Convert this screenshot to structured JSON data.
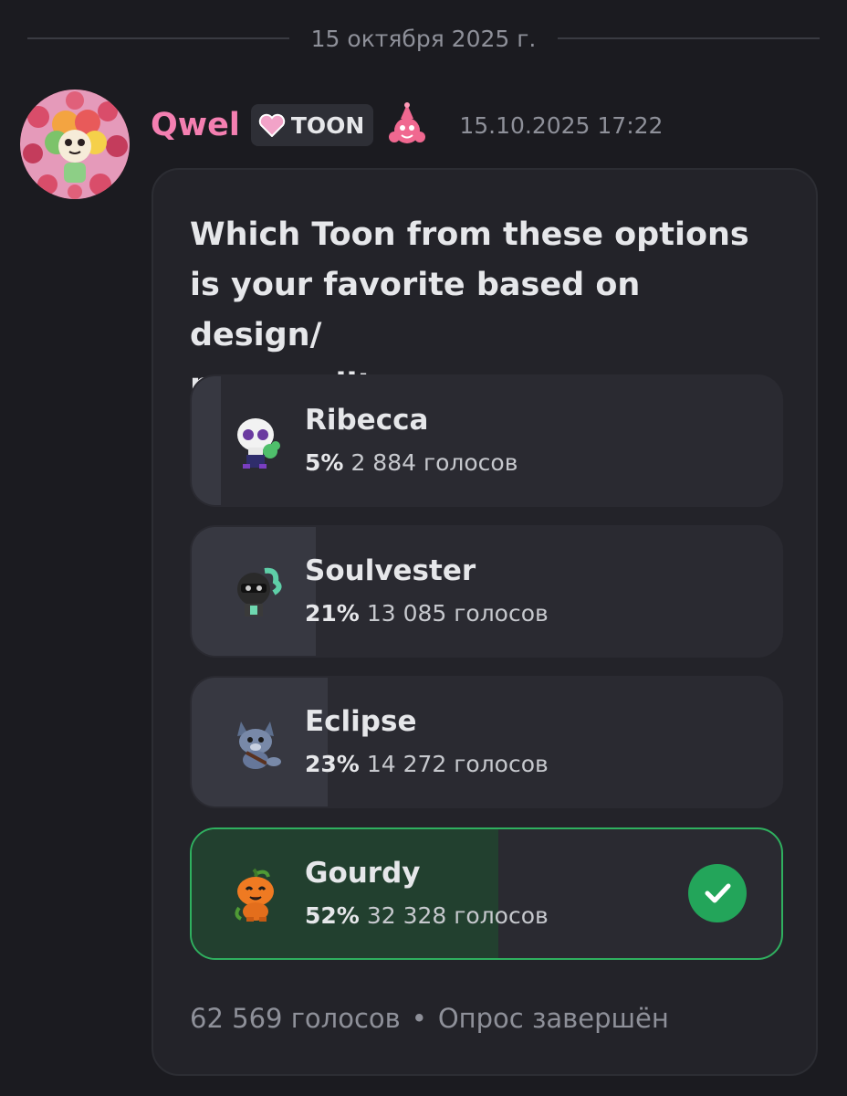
{
  "divider": {
    "date": "15 октября 2025 г."
  },
  "message": {
    "author": "Qwel",
    "tag": {
      "text": "TOON",
      "icon": "pink-heart-icon"
    },
    "decoration_icon": "pink-clown-icon",
    "timestamp": "15.10.2025 17:22"
  },
  "poll": {
    "question": "Which Toon from these options\nis your favorite based on design/\npersonality",
    "options": [
      {
        "name": "Ribecca",
        "percent": "5%",
        "votes": "2 884 голосов",
        "share": 0.05,
        "icon": "ribecca-skull-icon",
        "winner": false
      },
      {
        "name": "Soulvester",
        "percent": "21%",
        "votes": "13 085 голосов",
        "share": 0.21,
        "icon": "soulvester-icon",
        "winner": false
      },
      {
        "name": "Eclipse",
        "percent": "23%",
        "votes": "14 272 голосов",
        "share": 0.23,
        "icon": "eclipse-wolf-icon",
        "winner": false
      },
      {
        "name": "Gourdy",
        "percent": "52%",
        "votes": "32 328 голосов",
        "share": 0.52,
        "icon": "gourdy-pumpkin-icon",
        "winner": true
      }
    ],
    "total_votes": "62 569 голосов",
    "separator": "•",
    "status": "Опрос завершён",
    "colors": {
      "winner_border": "#2fb05f",
      "winner_check": "#23a55a",
      "username": "#f47fb1"
    }
  }
}
